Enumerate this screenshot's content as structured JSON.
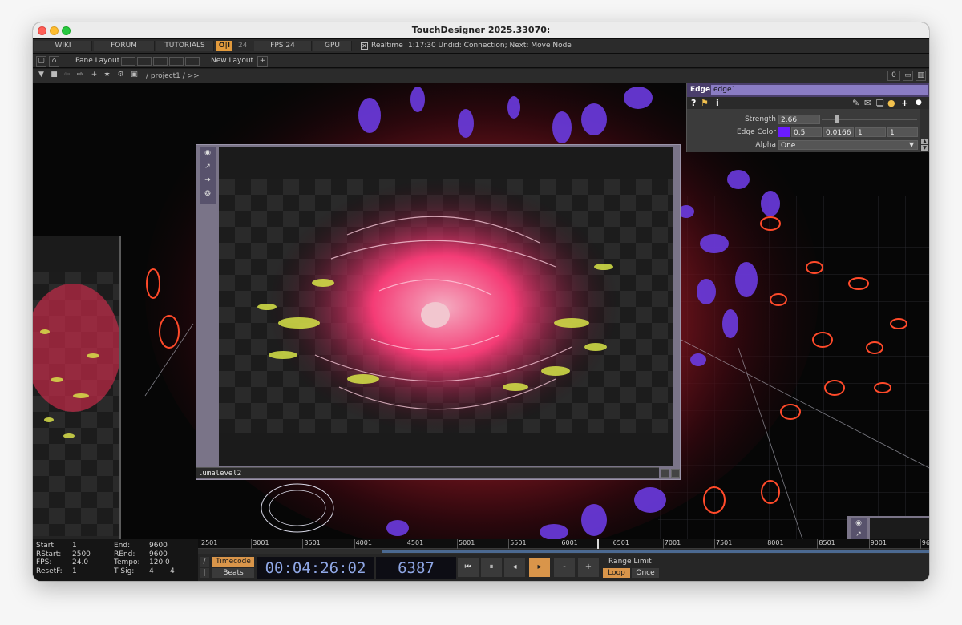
{
  "window": {
    "title": "TouchDesigner 2025.33070:"
  },
  "menubar": {
    "items": [
      "WIKI",
      "FORUM",
      "TUTORIALS"
    ],
    "perform_label": "O|I",
    "perform_value": "24",
    "fps_label": "FPS  24",
    "gpu_label": "GPU",
    "realtime_checked": "✕",
    "realtime_label": "Realtime",
    "status": "1:17:30 Undid: Connection; Next: Move Node"
  },
  "panebar": {
    "pane_layout_label": "Pane Layout",
    "new_layout_label": "New Layout",
    "add_label": "+"
  },
  "pathbar": {
    "path": "/ project1 / >>",
    "count": "0"
  },
  "parameters": {
    "op_type": "Edge",
    "op_name": "edge1",
    "strength_label": "Strength",
    "strength_value": "2.66",
    "edge_color_label": "Edge Color",
    "edge_color": "#6a1bff",
    "edge_color_r": "0.5",
    "edge_color_g": "0.0166",
    "edge_color_b": "1",
    "edge_color_a": "1",
    "alpha_label": "Alpha",
    "alpha_value": "One"
  },
  "viewer": {
    "node_name": "lumalevel2"
  },
  "timeline": {
    "start_label": "Start:",
    "start": "1",
    "end_label": "End:",
    "end": "9600",
    "rstart_label": "RStart:",
    "rstart": "2500",
    "rend_label": "REnd:",
    "rend": "9600",
    "fps_label": "FPS:",
    "fps": "24.0",
    "tempo_label": "Tempo:",
    "tempo": "120.0",
    "resetf_label": "ResetF:",
    "resetf": "1",
    "tsig_label": "T Sig:",
    "tsig_a": "4",
    "tsig_b": "4",
    "ticks": [
      "2501",
      "3001",
      "3501",
      "4001",
      "4501",
      "5001",
      "5501",
      "6001",
      "6501",
      "7001",
      "7501",
      "8001",
      "8501",
      "9001",
      "96"
    ],
    "timecode_label": "Timecode",
    "beats_label": "Beats",
    "timecode": "00:04:26:02",
    "frame": "6387",
    "range_limit_label": "Range Limit",
    "loop_label": "Loop",
    "once_label": "Once"
  }
}
